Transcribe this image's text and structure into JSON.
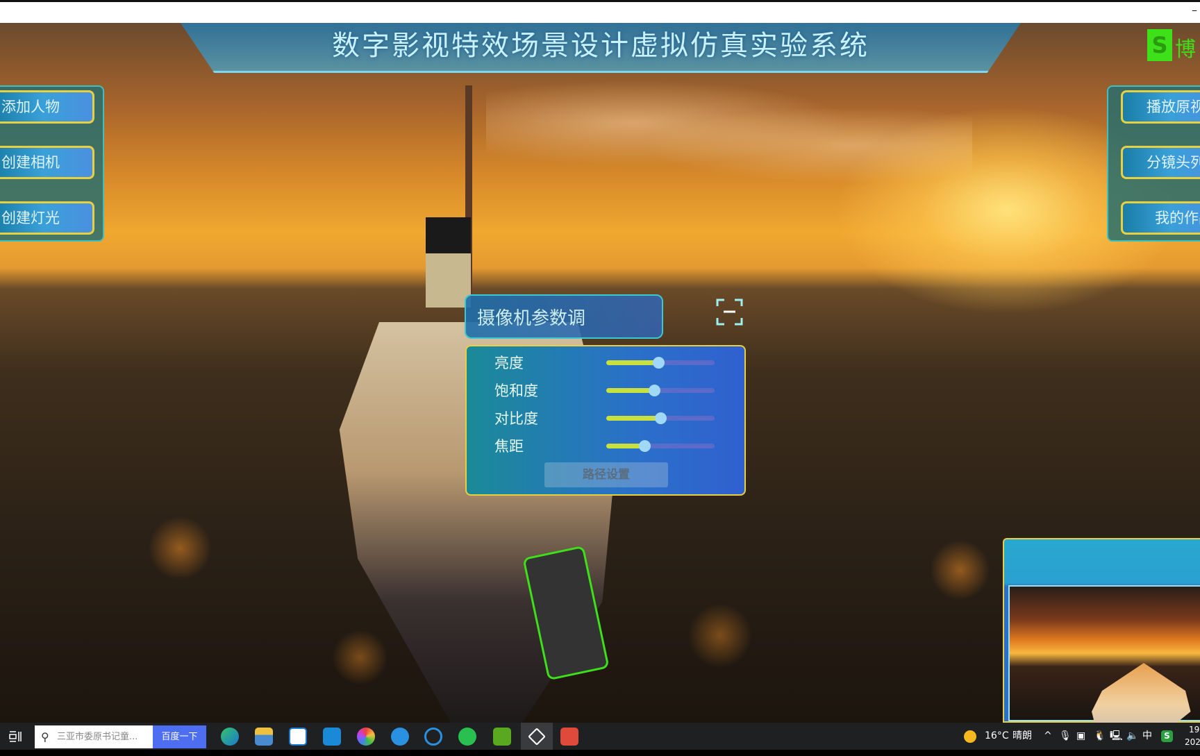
{
  "window": {
    "minimize_label": "–"
  },
  "app": {
    "title": "数字影视特效场景设计虚拟仿真实验系统",
    "logo_text": "S",
    "logo_word": "博"
  },
  "left_menu": [
    {
      "label": "添加人物"
    },
    {
      "label": "创建相机"
    },
    {
      "label": "创建灯光"
    }
  ],
  "right_menu": [
    {
      "label": "播放原视"
    },
    {
      "label": "分镜头列"
    },
    {
      "label": "我的作品"
    }
  ],
  "camera_panel": {
    "title": "摄像机参数调",
    "sliders": [
      {
        "label": "亮度",
        "value": 0.48
      },
      {
        "label": "饱和度",
        "value": 0.44
      },
      {
        "label": "对比度",
        "value": 0.5
      },
      {
        "label": "焦距",
        "value": 0.35
      }
    ],
    "path_button": "路径设置"
  },
  "colors": {
    "accent_yellow": "#e8d040",
    "slider_fill": "#c8e040",
    "panel_border": "#3cc8d0"
  },
  "taskbar": {
    "search_placeholder": "三亚市委原书记童...",
    "search_button": "百度一下",
    "apps": [
      "task-view",
      "edge",
      "file-explorer",
      "microsoft-store",
      "mail",
      "browser-360",
      "ie",
      "search-app",
      "wechat",
      "camtasia",
      "unity",
      "red-c-app"
    ],
    "weather_temp": "16°C",
    "weather_text": "晴朗",
    "ime": "中",
    "clock_time": "19",
    "clock_date": "202"
  }
}
